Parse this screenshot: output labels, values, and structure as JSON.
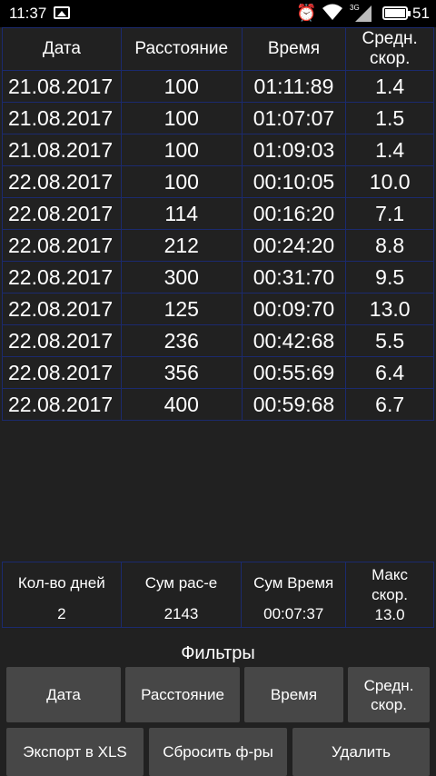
{
  "status_bar": {
    "time": "11:37",
    "signal_label": "3G",
    "battery_level": "51"
  },
  "columns": [
    "Дата",
    "Расстояние",
    "Время",
    "Средн. скор."
  ],
  "rows": [
    [
      "21.08.2017",
      "100",
      "01:11:89",
      "1.4"
    ],
    [
      "21.08.2017",
      "100",
      "01:07:07",
      "1.5"
    ],
    [
      "21.08.2017",
      "100",
      "01:09:03",
      "1.4"
    ],
    [
      "22.08.2017",
      "100",
      "00:10:05",
      "10.0"
    ],
    [
      "22.08.2017",
      "114",
      "00:16:20",
      "7.1"
    ],
    [
      "22.08.2017",
      "212",
      "00:24:20",
      "8.8"
    ],
    [
      "22.08.2017",
      "300",
      "00:31:70",
      "9.5"
    ],
    [
      "22.08.2017",
      "125",
      "00:09:70",
      "13.0"
    ],
    [
      "22.08.2017",
      "236",
      "00:42:68",
      "5.5"
    ],
    [
      "22.08.2017",
      "356",
      "00:55:69",
      "6.4"
    ],
    [
      "22.08.2017",
      "400",
      "00:59:68",
      "6.7"
    ]
  ],
  "totals": {
    "days_label": "Кол-во дней",
    "days_value": "2",
    "distance_label": "Сум рас-е",
    "distance_value": "2143",
    "time_label": "Сум Время",
    "time_value": "00:07:37",
    "speed_label": "Макс скор.",
    "speed_value": "13.0"
  },
  "filters": {
    "title": "Фильтры",
    "date": "Дата",
    "distance": "Расстояние",
    "time": "Время",
    "speed": "Средн. скор."
  },
  "actions": {
    "export": "Экспорт в XLS",
    "reset": "Сбросить ф-ры",
    "delete": "Удалить"
  },
  "colors": {
    "background": "#212121",
    "grid": "#1b2a6e",
    "button": "#474747"
  }
}
